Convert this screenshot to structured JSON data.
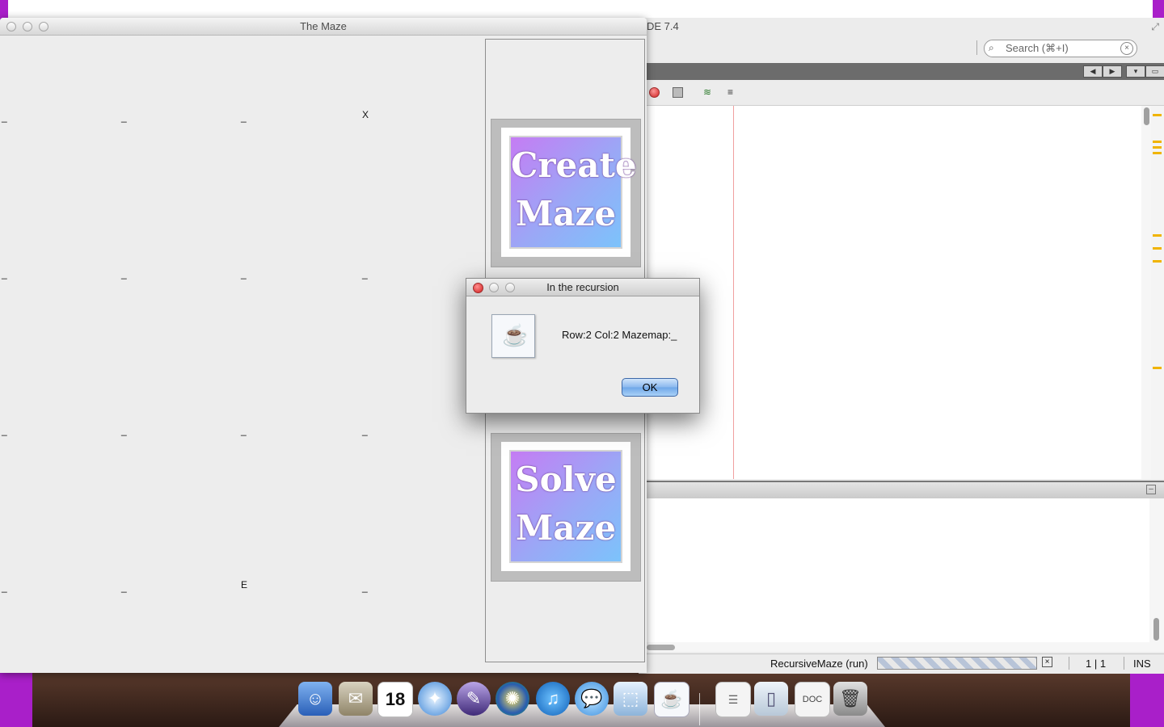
{
  "ide": {
    "title_fragment": "DE 7.4",
    "search_placeholder": "Search (⌘+I)",
    "status": {
      "run_label": "RecursiveMaze (run)",
      "position": "1 | 1",
      "mode": "INS"
    }
  },
  "maze_window": {
    "title": "The Maze",
    "cells": [
      {
        "text": "_"
      },
      {
        "text": "_"
      },
      {
        "text": "_"
      },
      {
        "text": "X"
      },
      {
        "text": "_"
      },
      {
        "text": "_"
      },
      {
        "text": "_"
      },
      {
        "text": "_"
      },
      {
        "text": "_"
      },
      {
        "text": "_"
      },
      {
        "text": "_"
      },
      {
        "text": "_"
      },
      {
        "text": "_"
      },
      {
        "text": "_"
      },
      {
        "text": "E"
      },
      {
        "text": "_"
      }
    ],
    "create_button": {
      "line1": "Create",
      "line2": "Maze"
    },
    "solve_button": {
      "line1": "Solve",
      "line2": "Maze"
    }
  },
  "dialog": {
    "title": "In the recursion",
    "message": "Row:2 Col:2 Mazemap:_",
    "ok_label": "OK"
  },
  "dock": {
    "calendar_day": "18",
    "items": [
      "finder-icon",
      "mail-icon",
      "calendar-icon",
      "safari-icon",
      "script-editor-icon",
      "game-icon",
      "itunes-icon",
      "messages-icon",
      "box-icon",
      "java-icon",
      "document-icon",
      "folder-icon",
      "doc-icon",
      "trash-icon"
    ]
  },
  "colors": {
    "desktop": "#a91fc9",
    "button_gradient_start": "#c57cf4",
    "button_gradient_end": "#7cc3fb"
  }
}
